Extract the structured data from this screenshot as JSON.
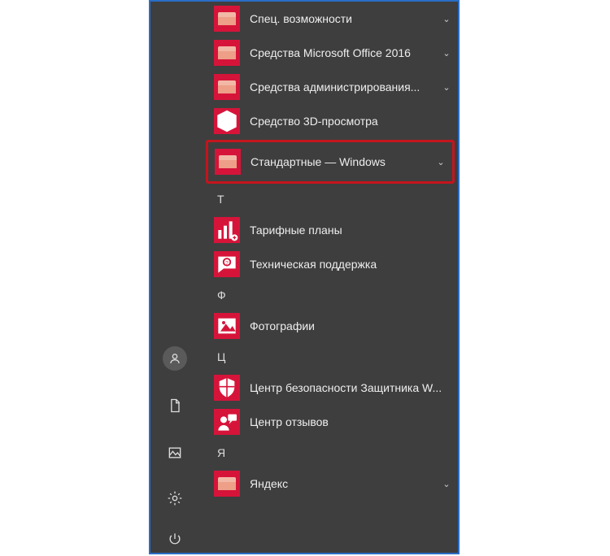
{
  "accent": "#d6143a",
  "items": [
    {
      "kind": "folder",
      "label": "Спец. возможности",
      "expandable": true
    },
    {
      "kind": "folder",
      "label": "Средства Microsoft Office 2016",
      "expandable": true
    },
    {
      "kind": "folder",
      "label": "Средства администрирования...",
      "expandable": true
    },
    {
      "kind": "app",
      "icon": "cube",
      "label": "Средство 3D-просмотра",
      "expandable": false
    },
    {
      "kind": "folder",
      "label": "Стандартные — Windows",
      "expandable": true,
      "highlighted": true
    },
    {
      "kind": "letter",
      "label": "Т"
    },
    {
      "kind": "app",
      "icon": "bars-plus",
      "label": "Тарифные планы",
      "expandable": false
    },
    {
      "kind": "app",
      "icon": "chat-question",
      "label": "Техническая поддержка",
      "expandable": false
    },
    {
      "kind": "letter",
      "label": "Ф"
    },
    {
      "kind": "app",
      "icon": "photo",
      "label": "Фотографии",
      "expandable": false
    },
    {
      "kind": "letter",
      "label": "Ц"
    },
    {
      "kind": "app",
      "icon": "shield",
      "label": "Центр безопасности Защитника W...",
      "expandable": false
    },
    {
      "kind": "app",
      "icon": "feedback-person",
      "label": "Центр отзывов",
      "expandable": false
    },
    {
      "kind": "letter",
      "label": "Я"
    },
    {
      "kind": "folder",
      "label": "Яндекс",
      "expandable": true
    }
  ],
  "rail": {
    "account": "account",
    "documents": "documents",
    "pictures": "pictures",
    "settings": "settings",
    "power": "power"
  }
}
